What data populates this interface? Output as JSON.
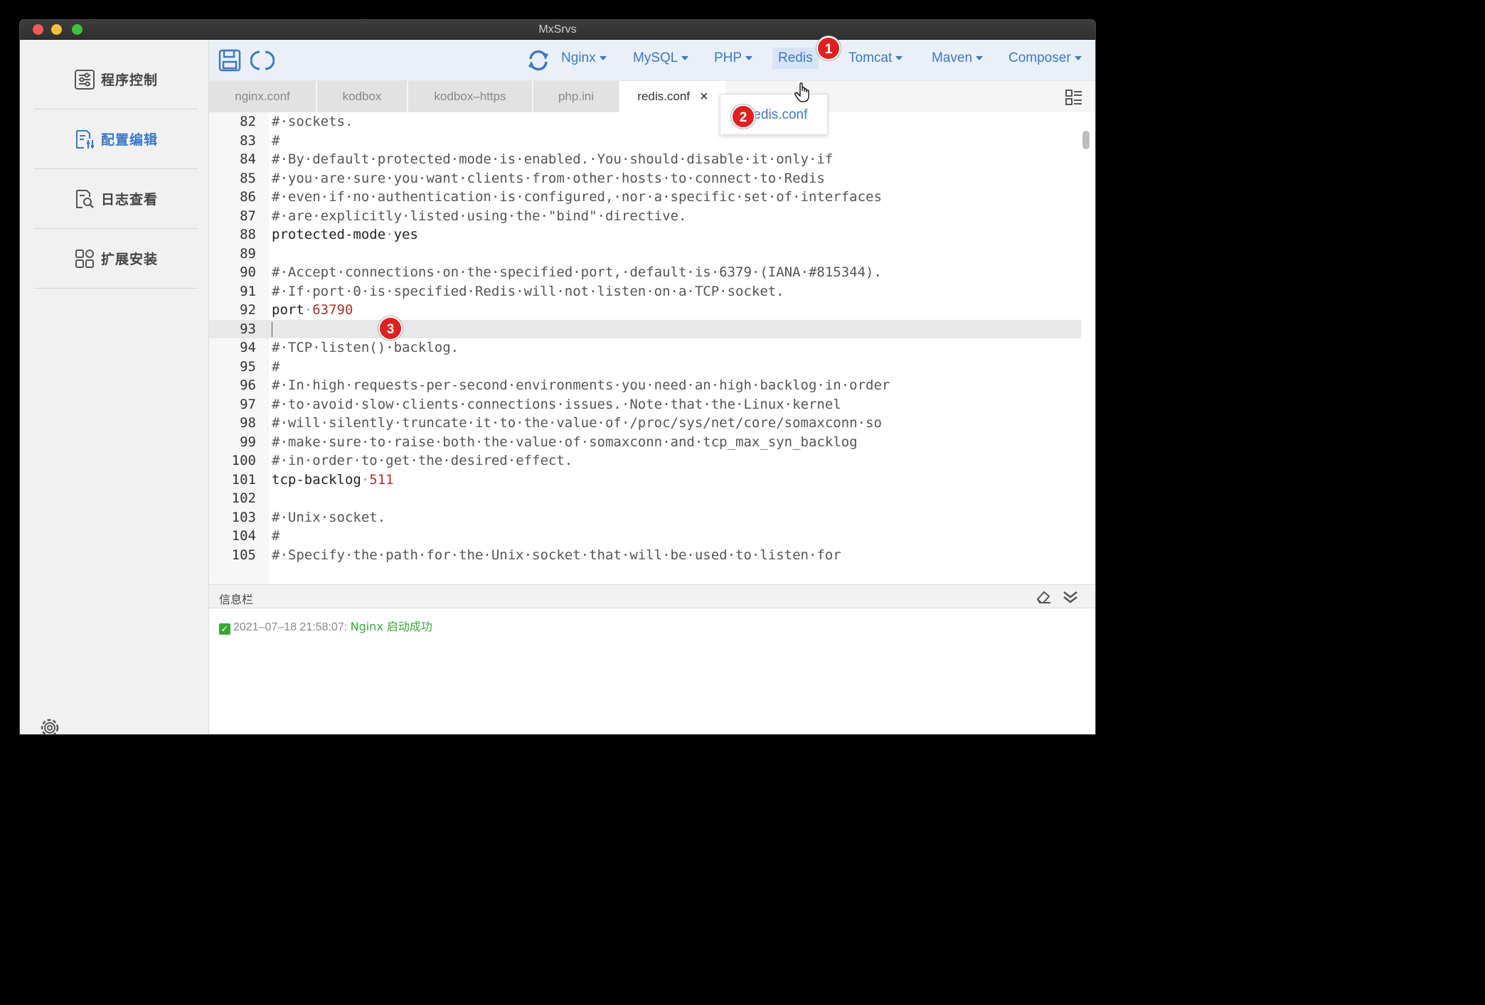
{
  "window": {
    "title": "MxSrvs"
  },
  "sidebar": {
    "items": [
      {
        "label": "程序控制",
        "icon": "sliders-icon"
      },
      {
        "label": "配置编辑",
        "icon": "config-edit-icon"
      },
      {
        "label": "日志查看",
        "icon": "log-search-icon"
      },
      {
        "label": "扩展安装",
        "icon": "extensions-icon"
      }
    ],
    "settings_icon": "settings-gear-icon"
  },
  "toolbar": {
    "menus": [
      "Nginx",
      "MySQL",
      "PHP",
      "Redis",
      "Tomcat",
      "Maven",
      "Composer"
    ]
  },
  "tabs": [
    "nginx.conf",
    "kodbox",
    "kodbox–https",
    "php.ini",
    "redis.conf"
  ],
  "active_tab_close": "×",
  "dropdown": {
    "item": "redis.conf"
  },
  "badges": {
    "b1": "1",
    "b2": "2",
    "b3": "3"
  },
  "editor": {
    "lines": [
      {
        "n": "82",
        "t": "#·sockets."
      },
      {
        "n": "83",
        "t": "#"
      },
      {
        "n": "84",
        "t": "#·By·default·protected·mode·is·enabled.·You·should·disable·it·only·if"
      },
      {
        "n": "85",
        "t": "#·you·are·sure·you·want·clients·from·other·hosts·to·connect·to·Redis"
      },
      {
        "n": "86",
        "t": "#·even·if·no·authentication·is·configured,·nor·a·specific·set·of·interfaces"
      },
      {
        "n": "87",
        "t": "#·are·explicitly·listed·using·the·\"bind\"·directive."
      },
      {
        "n": "88",
        "key": "protected-mode",
        "val": "yes",
        "valColor": "plain"
      },
      {
        "n": "89",
        "t": ""
      },
      {
        "n": "90",
        "t": "#·Accept·connections·on·the·specified·port,·default·is·6379·(IANA·#815344)."
      },
      {
        "n": "91",
        "t": "#·If·port·0·is·specified·Redis·will·not·listen·on·a·TCP·socket."
      },
      {
        "n": "92",
        "key": "port",
        "val": "63790",
        "valColor": "num"
      },
      {
        "n": "93",
        "t": "",
        "highlight": true
      },
      {
        "n": "94",
        "t": "#·TCP·listen()·backlog."
      },
      {
        "n": "95",
        "t": "#"
      },
      {
        "n": "96",
        "t": "#·In·high·requests-per-second·environments·you·need·an·high·backlog·in·order"
      },
      {
        "n": "97",
        "t": "#·to·avoid·slow·clients·connections·issues.·Note·that·the·Linux·kernel"
      },
      {
        "n": "98",
        "t": "#·will·silently·truncate·it·to·the·value·of·/proc/sys/net/core/somaxconn·so"
      },
      {
        "n": "99",
        "t": "#·make·sure·to·raise·both·the·value·of·somaxconn·and·tcp_max_syn_backlog"
      },
      {
        "n": "100",
        "t": "#·in·order·to·get·the·desired·effect."
      },
      {
        "n": "101",
        "key": "tcp-backlog",
        "val": "511",
        "valColor": "num"
      },
      {
        "n": "102",
        "t": ""
      },
      {
        "n": "103",
        "t": "#·Unix·socket."
      },
      {
        "n": "104",
        "t": "#"
      },
      {
        "n": "105",
        "t": "#·Specify·the·path·for·the·Unix·socket·that·will·be·used·to·listen·for"
      }
    ]
  },
  "infobar": {
    "title": "信息栏",
    "log_time": "2021–07–18 21:58:07:",
    "log_msg": "Nginx 启动成功"
  },
  "colors": {
    "accent": "#3d79c4",
    "badge": "#e02020",
    "success": "#3aa63a",
    "number": "#b5302a"
  }
}
